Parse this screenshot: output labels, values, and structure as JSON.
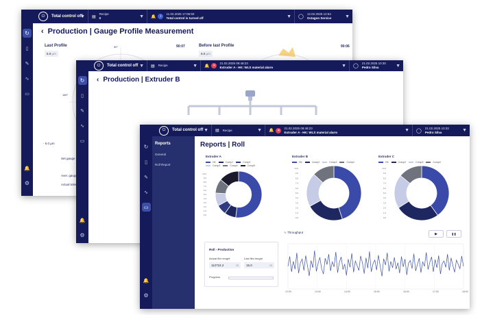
{
  "colors": {
    "navy": "#141a5a",
    "panel": "#26306e",
    "accent": "#3b4fa8",
    "alarm": "#e0415a"
  },
  "win1": {
    "status_title": "Total control off",
    "recipe_label": "Recipe",
    "recipe_value": "0",
    "event_time": "11.02.2025 17:06:50",
    "event_text": "Total control is turned off",
    "user_time": "12.02.2025 12:54",
    "user_name": "Octagon Service",
    "page_title": "Production | Gauge Profile Measurement",
    "left_profile": "Last Profile",
    "left_time": "90:07",
    "left_value": "6.0",
    "left_unit": "µm",
    "right_profile": "Before last Profile",
    "right_time": "90:06",
    "right_value": "6.0",
    "right_unit": "µm",
    "angle_top": "90°",
    "angle_left": "180°",
    "min_label": "- 6.0 µm",
    "set_gauge": "Set gauge",
    "aver_gauge": "Aver. gauge",
    "actual_tol": "Actual toler."
  },
  "win2": {
    "status_title": "Total control off",
    "recipe_label": "Recipe",
    "event_time": "21.02.2025 09:48:23",
    "event_text": "Extruder A - HK: WLS material alarm",
    "user_time": "21.02.2025 10:30",
    "user_name": "Pedro Silva",
    "page_title": "Production | Extruder B"
  },
  "win3": {
    "status_title": "Total control off",
    "recipe_label": "Recipe",
    "event_time": "21.02.2025 09:48:23",
    "event_text": "Extruder A - HK: WLS material alarm",
    "user_time": "21.02.2025 10:32",
    "user_name": "Pedro Silva",
    "nav_title": "Reports",
    "nav_items": [
      "General",
      "Roll Report"
    ],
    "page_title": "Reports |  Roll",
    "roll_panel_title": "Roll - Production",
    "actual_len_label": "Actual film lenght",
    "actual_len_value": "112724.2",
    "actual_len_unit": "m",
    "last_len_label": "Last film lenght",
    "last_len_value": "15.0",
    "last_len_unit": "m",
    "progress_label": "Progress",
    "progress_value": 0.0,
    "throughput_label": "Throughput",
    "play_label": "▶",
    "pause_label": "❚❚",
    "time_ticks": [
      "12:00",
      "13:00",
      "14:00",
      "15:00",
      "16:00",
      "17:00",
      "18:00"
    ]
  },
  "chart_data": [
    {
      "type": "pie",
      "title": "Extruder A",
      "categories": [
        "HK",
        "Comp1",
        "Comp2",
        "Comp3",
        "Comp4",
        "Comp5"
      ],
      "values": [
        52,
        8,
        7,
        9,
        10,
        14
      ],
      "colors": [
        "#3a4aa8",
        "#1f2760",
        "#2e3a82",
        "#c6cce6",
        "#6f737e",
        "#1a1a2a"
      ],
      "ylim": [
        0,
        10
      ]
    },
    {
      "type": "pie",
      "title": "Extruder B",
      "categories": [
        "HK",
        "Comp2",
        "Comp3",
        "Comp4"
      ],
      "values": [
        45,
        22,
        20,
        13
      ],
      "colors": [
        "#3a4aa8",
        "#1f2760",
        "#c6cce6",
        "#6f737e"
      ],
      "ylim": [
        0,
        10
      ]
    },
    {
      "type": "pie",
      "title": "Extruder C",
      "categories": [
        "HK",
        "Comp2",
        "Comp3",
        "Comp4"
      ],
      "values": [
        40,
        26,
        20,
        14
      ],
      "colors": [
        "#3a4aa8",
        "#1f2760",
        "#c6cce6",
        "#6f737e"
      ],
      "ylim": [
        0,
        10
      ]
    },
    {
      "type": "line",
      "title": "Throughput",
      "x": [
        "12:00",
        "18:00"
      ],
      "series": [
        {
          "values": [
            50,
            72,
            38,
            61,
            44,
            80,
            35,
            58,
            66,
            41,
            74,
            52,
            29,
            63,
            47,
            85,
            39,
            57,
            70,
            45,
            33,
            68,
            54,
            77,
            40,
            60,
            49,
            82,
            36,
            59,
            71,
            43,
            55,
            30,
            66,
            48,
            79,
            37,
            62,
            52,
            41,
            73,
            58,
            34,
            69,
            46,
            83,
            38,
            56,
            64,
            42,
            75,
            51,
            28,
            67,
            53,
            80,
            39,
            61,
            47,
            70,
            44,
            58,
            35,
            72,
            49,
            66,
            31,
            57,
            63,
            45,
            78,
            40,
            54,
            68,
            36,
            60,
            50,
            81,
            43,
            59,
            71,
            38,
            65,
            47,
            74,
            33,
            56,
            62,
            48,
            77,
            41,
            69,
            52,
            37,
            64,
            55,
            45,
            73,
            50
          ]
        }
      ],
      "ylim": [
        0,
        100
      ]
    }
  ]
}
